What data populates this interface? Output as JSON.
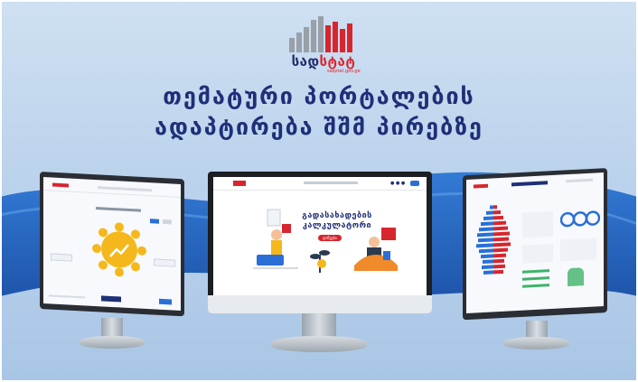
{
  "logo": {
    "word_blue": "სად",
    "word_red": "სტატ",
    "tagline": "saqstat.gov.ge"
  },
  "headline": {
    "line1": "თემატური პორტალების",
    "line2": "ადაპტირება შშმ პირებზე"
  },
  "center_screen": {
    "calculator_title": "გადასახადების კალკულატორი",
    "start_button": "დაწყება"
  },
  "colors": {
    "title": "#1f2f78",
    "brand_red": "#d7262e",
    "brand_navy": "#1f2b6b",
    "wave": "#1e63c6"
  },
  "icons": [
    "bar-chart-logo-icon",
    "accessibility-wheel-icon",
    "people-illustration-icon",
    "pyramid-chart-icon"
  ]
}
